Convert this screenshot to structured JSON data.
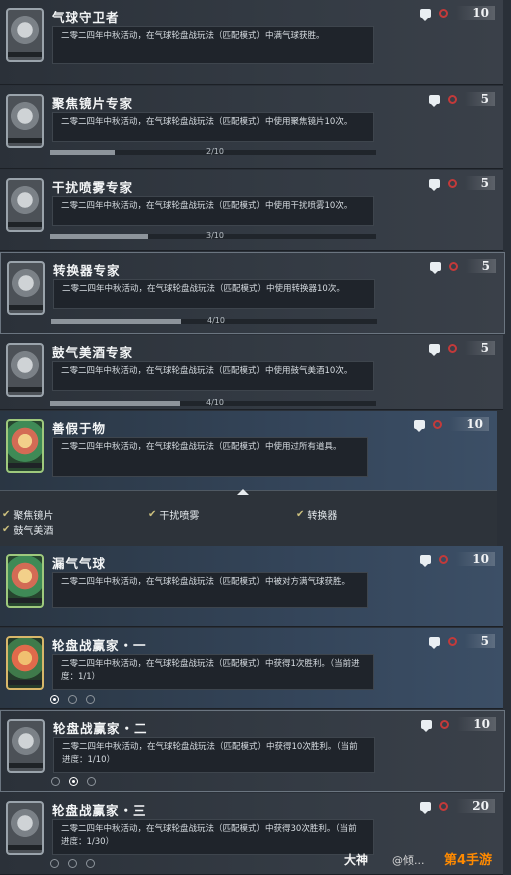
{
  "achievements": [
    {
      "title": "气球守卫者",
      "desc": "二零二四年中秋活动，在气球轮盘战玩法（匹配模式）中满气球获胜。",
      "score": "10",
      "progress_text": "",
      "progress": null
    },
    {
      "title": "聚焦镜片专家",
      "desc": "二零二四年中秋活动，在气球轮盘战玩法（匹配模式）中使用聚焦镜片10次。",
      "score": "5",
      "progress_text": "2/10",
      "progress": 0.2
    },
    {
      "title": "干扰喷雾专家",
      "desc": "二零二四年中秋活动，在气球轮盘战玩法（匹配模式）中使用干扰喷雾10次。",
      "score": "5",
      "progress_text": "3/10",
      "progress": 0.3
    },
    {
      "title": "转换器专家",
      "desc": "二零二四年中秋活动，在气球轮盘战玩法（匹配模式）中使用转换器10次。",
      "score": "5",
      "progress_text": "4/10",
      "progress": 0.4
    },
    {
      "title": "鼓气美酒专家",
      "desc": "二零二四年中秋活动，在气球轮盘战玩法（匹配模式）中使用鼓气美酒10次。",
      "score": "5",
      "progress_text": "4/10",
      "progress": 0.4
    },
    {
      "title": "善假于物",
      "desc": "二零二四年中秋活动，在气球轮盘战玩法（匹配模式）中使用过所有道具。",
      "score": "10"
    },
    {
      "title": "漏气气球",
      "desc": "二零二四年中秋活动，在气球轮盘战玩法（匹配模式）中被对方满气球获胜。",
      "score": "10"
    },
    {
      "title": "轮盘战赢家・一",
      "desc": "二零二四年中秋活动，在气球轮盘战玩法（匹配模式）中获得1次胜利。（当前进度：1/1）",
      "score": "5"
    },
    {
      "title": "轮盘战赢家・二",
      "desc": "二零二四年中秋活动，在气球轮盘战玩法（匹配模式）中获得10次胜利。（当前进度：1/10）",
      "score": "10"
    },
    {
      "title": "轮盘战赢家・三",
      "desc": "二零二四年中秋活动，在气球轮盘战玩法（匹配模式）中获得30次胜利。（当前进度：1/30）",
      "score": "20"
    }
  ],
  "sub_items": [
    "聚焦镜片",
    "干扰喷雾",
    "转换器",
    "鼓气美酒"
  ],
  "watermark": {
    "left": "大神",
    "mid": "@倾...",
    "right": "第4手游"
  },
  "colors": {
    "accent_red": "#c33a3a",
    "gold_check": "#cbbf7d"
  },
  "icons": [
    "chat-icon",
    "target-icon",
    "check-icon",
    "thumbnail-icon"
  ]
}
